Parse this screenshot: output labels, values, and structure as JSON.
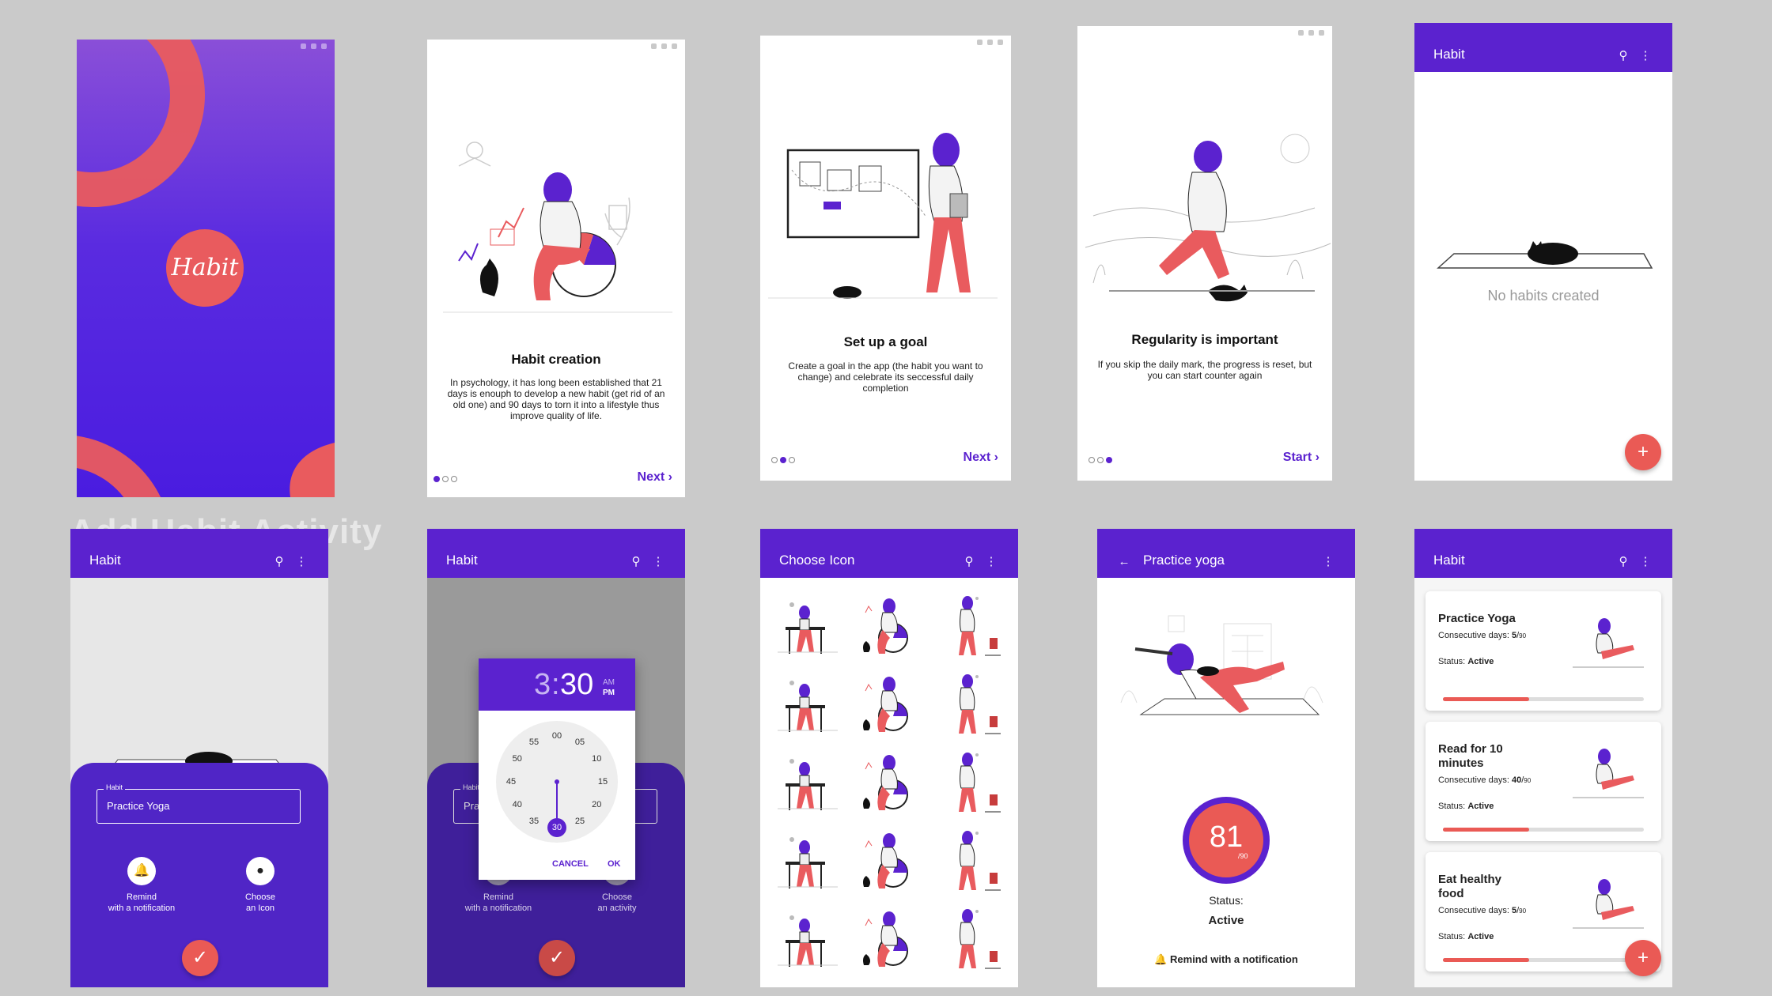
{
  "ghost_text": "Add Habit Activity",
  "splash": {
    "logo": "Habit"
  },
  "onboarding": [
    {
      "title": "Habit creation",
      "text": "In psychology, it has long been established that 21 days is enouph to develop a new habit (get rid of an old one) and 90 days to torn it into a lifestyle thus improve quality of life.",
      "action": "Next"
    },
    {
      "title": "Set up a goal",
      "text": "Create a goal in the app (the habit you want to change) and celebrate its seccessful daily completion",
      "action": "Next"
    },
    {
      "title": "Regularity is important",
      "text": "If you skip the daily mark, the progress is reset, but you can start counter again",
      "action": "Start"
    }
  ],
  "empty": {
    "appbar_title": "Habit",
    "message": "No habits created",
    "fab": "+"
  },
  "create": {
    "appbar_title": "Habit",
    "field_label": "Habit",
    "field_value": "Practice Yoga",
    "remind_label_1": "Remind",
    "remind_label_2": "with a notification",
    "choose_label_1": "Choose",
    "choose_label_2": "an Icon",
    "fab": "✓"
  },
  "timepicker": {
    "appbar_title": "Habit",
    "hour": "3",
    "minute": "30",
    "am": "AM",
    "pm": "PM",
    "cancel": "CANCEL",
    "ok": "OK",
    "minutes": [
      "00",
      "05",
      "10",
      "15",
      "20",
      "25",
      "30",
      "35",
      "40",
      "45",
      "50",
      "55"
    ],
    "selected_minute": "30",
    "bg_field_label": "Habit",
    "bg_field_value": "Pra",
    "remind_label_1": "Remind",
    "remind_label_2": "with a notification",
    "choose_label_1": "Choose",
    "choose_label_2": "an activity",
    "fab": "✓"
  },
  "icons": {
    "appbar_title": "Choose Icon"
  },
  "detail": {
    "appbar_title": "Practice yoga",
    "count": "81",
    "total": "90",
    "status_label": "Status:",
    "status_value": "Active",
    "remind": "Remind with a notification"
  },
  "list": {
    "appbar_title": "Habit",
    "fab": "+",
    "consecutive_label": "Consecutive days:",
    "status_label": "Status:",
    "habits": [
      {
        "name": "Practice Yoga",
        "done": "5",
        "total": "90",
        "status": "Active",
        "progress": 0.43
      },
      {
        "name": "Read for 10 minutes",
        "done": "40",
        "total": "90",
        "status": "Active",
        "progress": 0.43
      },
      {
        "name": "Eat healthy food",
        "done": "5",
        "total": "90",
        "status": "Active",
        "progress": 0.43
      }
    ]
  },
  "colors": {
    "primary": "#5b22cf",
    "accent": "#ea5a55",
    "panel": "#5025c6"
  },
  "icons_meta": [
    "search-icon",
    "more-vert-icon",
    "back-arrow-icon",
    "bell-icon",
    "check-icon",
    "plus-icon",
    "chevron-right-icon"
  ]
}
